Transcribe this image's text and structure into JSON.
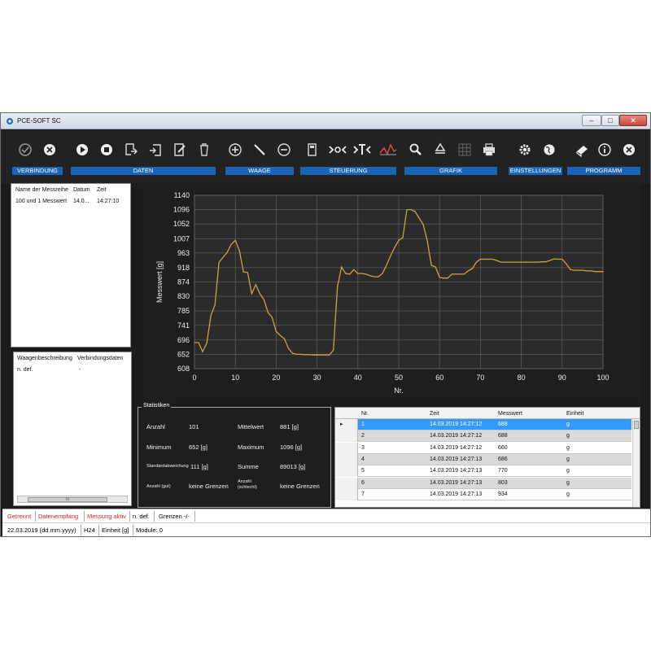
{
  "window": {
    "title": "PCE-SOFT SC"
  },
  "toolbar": {
    "groups": [
      {
        "label": "VERBINDUNG"
      },
      {
        "label": "DATEN"
      },
      {
        "label": "WAAGE"
      },
      {
        "label": "STEUERUNG"
      },
      {
        "label": "GRAFIK"
      },
      {
        "label": "EINSTELLUNGEN"
      },
      {
        "label": "PROGRAMM"
      }
    ],
    "buttons": [
      "connect-icon",
      "disconnect-icon",
      "play-icon",
      "stop-icon",
      "export-icon",
      "import-icon",
      "edit-icon",
      "delete-icon",
      "plus-icon",
      "line-icon",
      "minus-icon",
      "calculator-icon",
      "statistic-icon",
      "tolerance-icon",
      "graph-icon",
      "search-icon",
      "recycle-icon",
      "grid-icon",
      "print-icon",
      "gear-icon",
      "globe-icon",
      "book-icon",
      "info-icon",
      "exit-icon"
    ]
  },
  "series_list": {
    "headers": [
      "Name der Messreihe",
      "Datum",
      "Zeit"
    ],
    "rows": [
      [
        "100 und 1 Messwert",
        "14.0...",
        "14:27:10"
      ]
    ]
  },
  "scale_list": {
    "headers": [
      "Waagenbeschreibung",
      "Verbindungsdaten"
    ],
    "rows": [
      [
        "n. def.",
        "-"
      ]
    ],
    "scroll_label": "III"
  },
  "chart_data": {
    "type": "line",
    "xlabel": "Nr.",
    "ylabel": "Messwert [g]",
    "xlim": [
      0,
      100
    ],
    "ylim": [
      608,
      1140
    ],
    "xticks": [
      0,
      10,
      20,
      30,
      40,
      50,
      60,
      70,
      80,
      90,
      100
    ],
    "yticks": [
      608,
      652,
      696,
      741,
      785,
      830,
      874,
      918,
      963,
      1007,
      1052,
      1096,
      1140
    ],
    "grid": true,
    "line_color": "#c8a43a",
    "x": [
      0,
      1,
      2,
      3,
      4,
      5,
      6,
      7,
      8,
      9,
      10,
      11,
      12,
      13,
      14,
      15,
      16,
      17,
      18,
      19,
      20,
      21,
      22,
      23,
      24,
      25,
      26,
      27,
      28,
      29,
      30,
      31,
      32,
      33,
      34,
      35,
      36,
      37,
      38,
      39,
      40,
      41,
      42,
      43,
      44,
      45,
      46,
      47,
      48,
      49,
      50,
      51,
      52,
      53,
      54,
      55,
      56,
      57,
      58,
      59,
      60,
      61,
      62,
      63,
      64,
      65,
      66,
      67,
      68,
      69,
      70,
      71,
      72,
      73,
      74,
      75,
      76,
      77,
      78,
      79,
      80,
      81,
      82,
      83,
      84,
      85,
      86,
      87,
      88,
      89,
      90,
      91,
      92,
      93,
      94,
      95,
      96,
      97,
      98,
      99,
      100
    ],
    "y": [
      688,
      688,
      660,
      686,
      770,
      803,
      934,
      950,
      965,
      990,
      1002,
      970,
      905,
      903,
      838,
      866,
      838,
      820,
      780,
      765,
      722,
      710,
      700,
      670,
      655,
      652,
      652,
      651,
      651,
      650,
      650,
      650,
      650,
      650,
      665,
      860,
      920,
      900,
      898,
      912,
      900,
      900,
      898,
      893,
      890,
      890,
      900,
      925,
      955,
      980,
      1002,
      1010,
      1096,
      1096,
      1090,
      1070,
      1050,
      1000,
      925,
      920,
      888,
      886,
      886,
      898,
      898,
      898,
      898,
      908,
      915,
      935,
      944,
      944,
      944,
      944,
      940,
      935,
      935,
      935,
      935,
      935,
      935,
      935,
      935,
      935,
      935,
      936,
      936,
      940,
      945,
      944,
      944,
      930,
      912,
      910,
      910,
      910,
      908,
      908,
      906,
      906,
      906
    ]
  },
  "statistics": {
    "title": "Statistiken",
    "count_label": "Anzahl",
    "count_value": "101",
    "mean_label": "Mittelwert",
    "mean_value": "881 [g]",
    "min_label": "Minimum",
    "min_value": "652 [g]",
    "max_label": "Maximum",
    "max_value": "1096 [g]",
    "std_label": "Standardabweichung",
    "std_value": "111 [g]",
    "sum_label": "Summe",
    "sum_value": "89013 [g]",
    "good_label": "Anzahl (gut)",
    "good_value": "keine Grenzen",
    "bad_label": "Anzahl (schlecht)",
    "bad_value": "keine Grenzen"
  },
  "table": {
    "headers": [
      "Nr.",
      "Zeit",
      "Messwert",
      "Einheit"
    ],
    "rows": [
      [
        "1",
        "14.03.2019 14:27:12",
        "688",
        "g"
      ],
      [
        "2",
        "14.03.2019 14:27:12",
        "688",
        "g"
      ],
      [
        "3",
        "14.03.2019 14:27:12",
        "660",
        "g"
      ],
      [
        "4",
        "14.03.2019 14:27:13",
        "686",
        "g"
      ],
      [
        "5",
        "14.03.2019 14:27:13",
        "770",
        "g"
      ],
      [
        "6",
        "14.03.2019 14:27:13",
        "803",
        "g"
      ],
      [
        "7",
        "14.03.2019 14:27:13",
        "934",
        "g"
      ]
    ],
    "selected_row": 0
  },
  "status": {
    "separated": "Getrennt",
    "receiving": "Datenempfang",
    "measuring": "Messung aktiv",
    "undefined": "n. def.",
    "limits": "Grenzen -/-",
    "date": "22.03.2019 (dd.mm.yyyy)",
    "clock": "H24",
    "unit": "Einheit [g]",
    "modules": "Module: 0",
    "alert_color": "#e02020"
  }
}
